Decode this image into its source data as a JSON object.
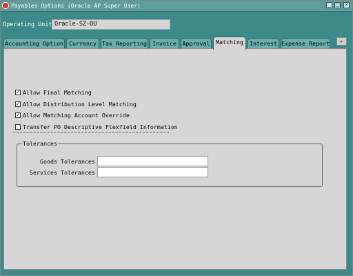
{
  "window": {
    "title": "Payables Options (Oracle AP Super User)"
  },
  "operating_unit": {
    "label": "Operating Unit",
    "value": "Oracle-SZ-OU"
  },
  "tabs": [
    {
      "label": "Accounting Option",
      "active": false
    },
    {
      "label": "Currency",
      "active": false
    },
    {
      "label": "Tax Reporting",
      "active": false
    },
    {
      "label": "Invoice",
      "active": false
    },
    {
      "label": "Approval",
      "active": false
    },
    {
      "label": "Matching",
      "active": true
    },
    {
      "label": "Interest",
      "active": false
    },
    {
      "label": "Expense Report",
      "active": false
    }
  ],
  "options": [
    {
      "label": "Allow Final Matching",
      "checked": true
    },
    {
      "label": "Allow Distribution Level Matching",
      "checked": true
    },
    {
      "label": "Allow Matching Account Override",
      "checked": true
    },
    {
      "label": "Transfer PO Descriptive Flexfield Information",
      "checked": false
    }
  ],
  "tolerances": {
    "title": "Tolerances",
    "goods_label": "Goods Tolerances",
    "goods_value": "",
    "services_label": "Services Tolerances",
    "services_value": ""
  }
}
